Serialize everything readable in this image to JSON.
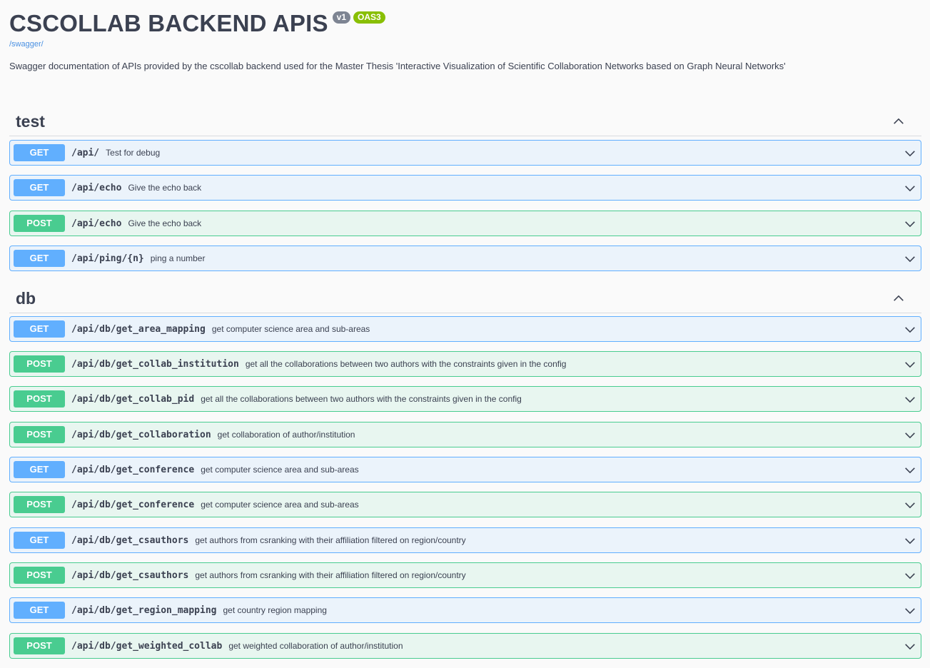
{
  "info": {
    "title": "CSCOLLAB BACKEND APIS",
    "version_badge": "v1",
    "oas_badge": "OAS3",
    "url": "/swagger/",
    "description": "Swagger documentation of APIs provided by the cscollab backend used for the Master Thesis 'Interactive Visualization of Scientific Collaboration Networks based on Graph Neural Networks'"
  },
  "icons": {
    "collapse": "chevron-up-icon",
    "expand": "chevron-down-icon"
  },
  "colors": {
    "get": "#61affe",
    "post": "#49cc90"
  },
  "sections": [
    {
      "name": "test",
      "operations": [
        {
          "method": "GET",
          "path": "/api/",
          "summary": "Test for debug"
        },
        {
          "method": "GET",
          "path": "/api/echo",
          "summary": "Give the echo back"
        },
        {
          "method": "POST",
          "path": "/api/echo",
          "summary": "Give the echo back"
        },
        {
          "method": "GET",
          "path": "/api/ping/{n}",
          "summary": "ping a number"
        }
      ]
    },
    {
      "name": "db",
      "operations": [
        {
          "method": "GET",
          "path": "/api/db/get_area_mapping",
          "summary": "get computer science area and sub-areas"
        },
        {
          "method": "POST",
          "path": "/api/db/get_collab_institution",
          "summary": "get all the collaborations between two authors with the constraints given in the config"
        },
        {
          "method": "POST",
          "path": "/api/db/get_collab_pid",
          "summary": "get all the collaborations between two authors with the constraints given in the config"
        },
        {
          "method": "POST",
          "path": "/api/db/get_collaboration",
          "summary": "get collaboration of author/institution"
        },
        {
          "method": "GET",
          "path": "/api/db/get_conference",
          "summary": "get computer science area and sub-areas"
        },
        {
          "method": "POST",
          "path": "/api/db/get_conference",
          "summary": "get computer science area and sub-areas"
        },
        {
          "method": "GET",
          "path": "/api/db/get_csauthors",
          "summary": "get authors from csranking with their affiliation filtered on region/country"
        },
        {
          "method": "POST",
          "path": "/api/db/get_csauthors",
          "summary": "get authors from csranking with their affiliation filtered on region/country"
        },
        {
          "method": "GET",
          "path": "/api/db/get_region_mapping",
          "summary": "get country region mapping"
        },
        {
          "method": "POST",
          "path": "/api/db/get_weighted_collab",
          "summary": "get weighted collaboration of author/institution"
        }
      ]
    }
  ]
}
